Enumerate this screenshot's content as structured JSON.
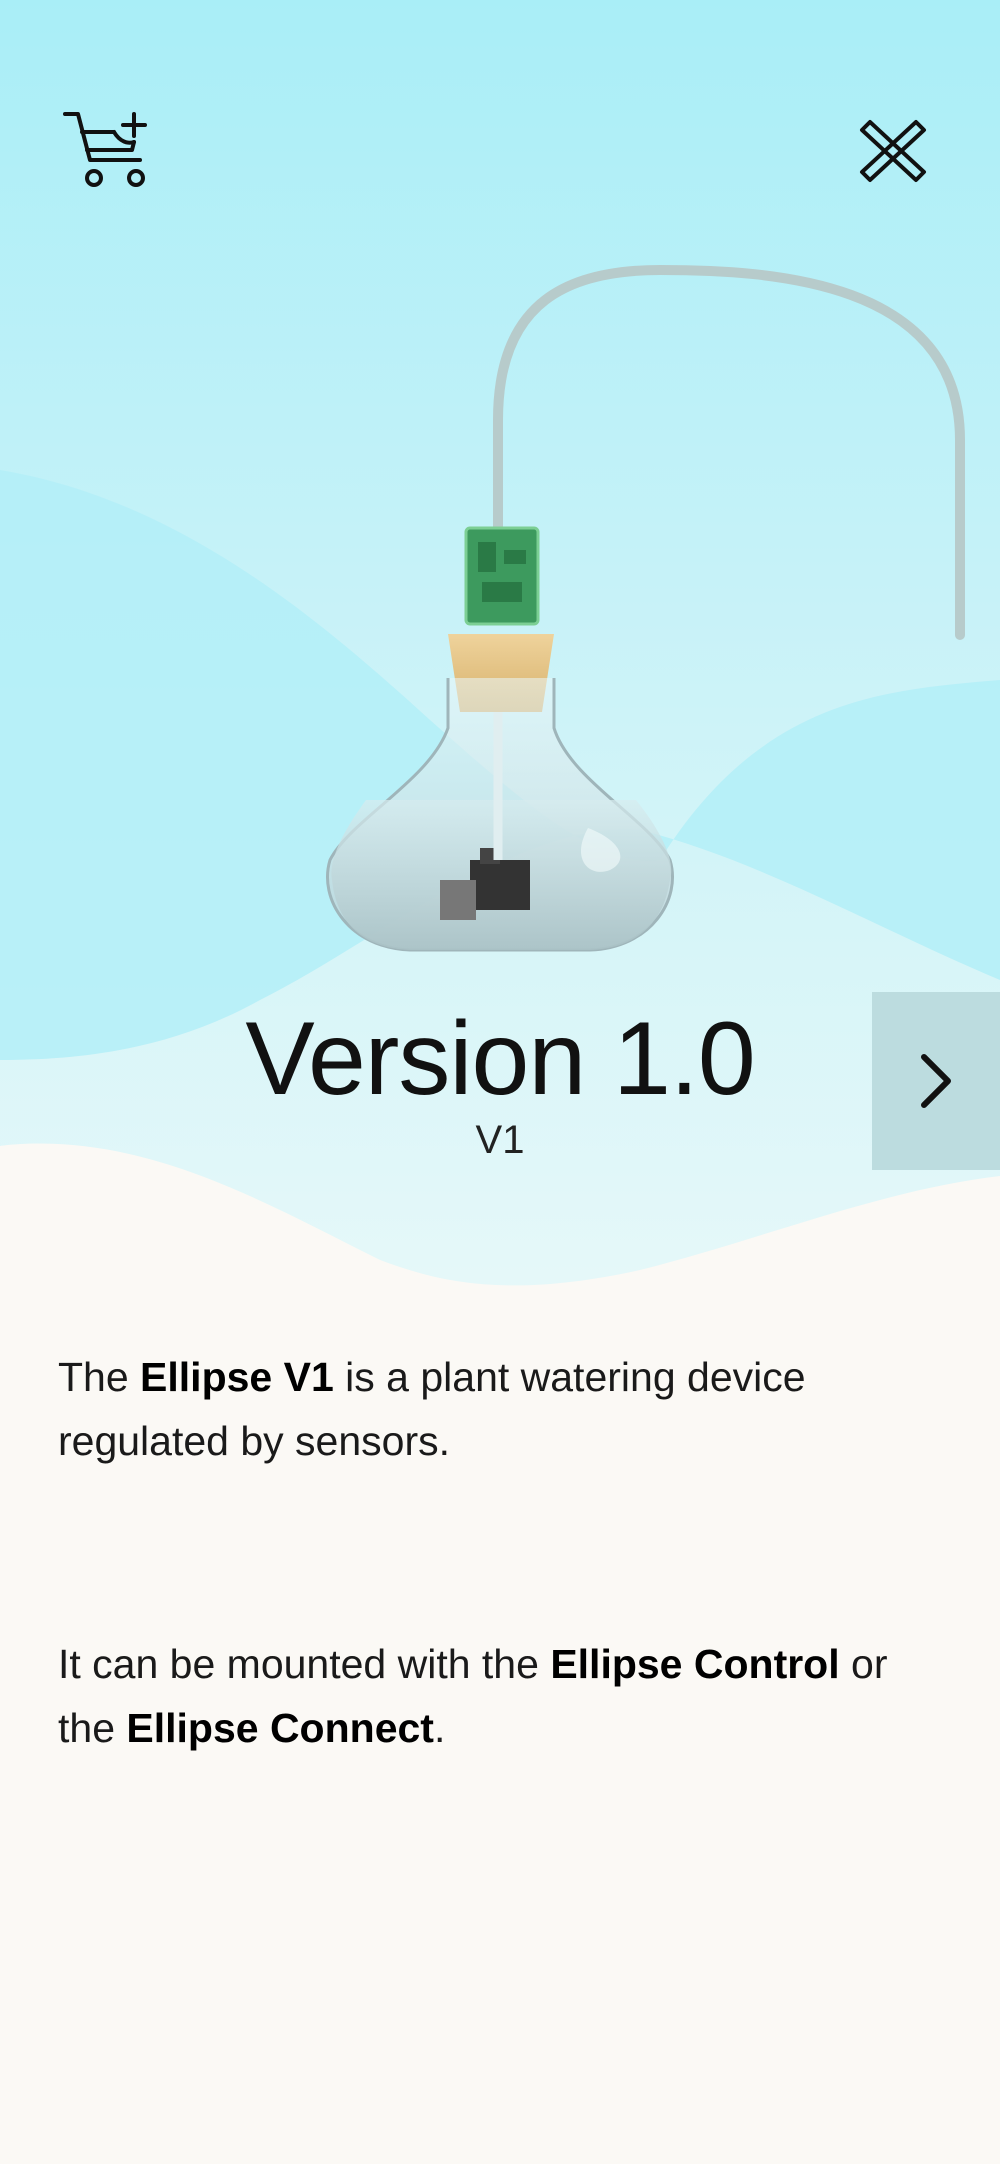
{
  "header": {
    "cart_icon": "add-to-cart-icon",
    "close_icon": "close-icon"
  },
  "product": {
    "title": "Version 1.0",
    "subtitle": "V1",
    "next_icon": "chevron-right-icon"
  },
  "description": {
    "p1_before": "The ",
    "p1_bold": "Ellipse V1",
    "p1_after": " is a plant watering device regulated by sensors.",
    "p2_before": "It can be mounted with the ",
    "p2_bold1": "Ellipse Control",
    "p2_mid": " or the ",
    "p2_bold2": "Ellipse Connect",
    "p2_after": "."
  },
  "colors": {
    "sky_top": "#a9eef7",
    "wave": "#b3eef8",
    "page_bg": "#fbf9f5",
    "next_bg": "#bcdcdf"
  }
}
